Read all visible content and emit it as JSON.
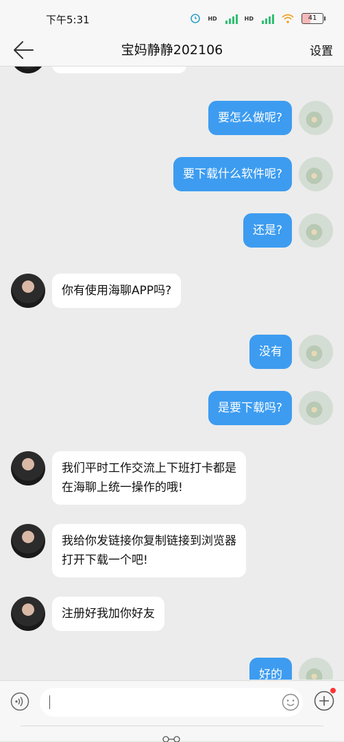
{
  "status": {
    "time": "下午5:31",
    "hd1": "HD",
    "hd2": "HD",
    "battery": "41"
  },
  "header": {
    "title": "宝妈静静202106",
    "settings_label": "设置"
  },
  "messages": [
    {
      "side": "out",
      "text": "要怎么做呢?"
    },
    {
      "side": "out",
      "text": "要下载什么软件呢?"
    },
    {
      "side": "out",
      "text": "还是?"
    },
    {
      "side": "in",
      "text": "你有使用海聊APP吗?"
    },
    {
      "side": "out",
      "text": "没有"
    },
    {
      "side": "out",
      "text": "是要下载吗?"
    },
    {
      "side": "in",
      "text_lines": [
        "我们平时工作交流上下班打卡都是",
        "在海聊上统一操作的哦!"
      ]
    },
    {
      "side": "in",
      "text_lines": [
        "我给你发链接你复制链接到浏览器",
        "打开下载一个吧!"
      ]
    },
    {
      "side": "in",
      "text": "注册好我加你好友"
    },
    {
      "side": "out",
      "text": "好的"
    }
  ],
  "input": {
    "value": "",
    "placeholder": ""
  },
  "icons": {
    "back": "arrow-left-icon",
    "voice": "voice-icon",
    "emoji": "smiley-icon",
    "plus": "plus-icon"
  },
  "colors": {
    "outgoing_bubble": "#3d9cf0",
    "incoming_bubble": "#ffffff",
    "background": "#ececec"
  }
}
